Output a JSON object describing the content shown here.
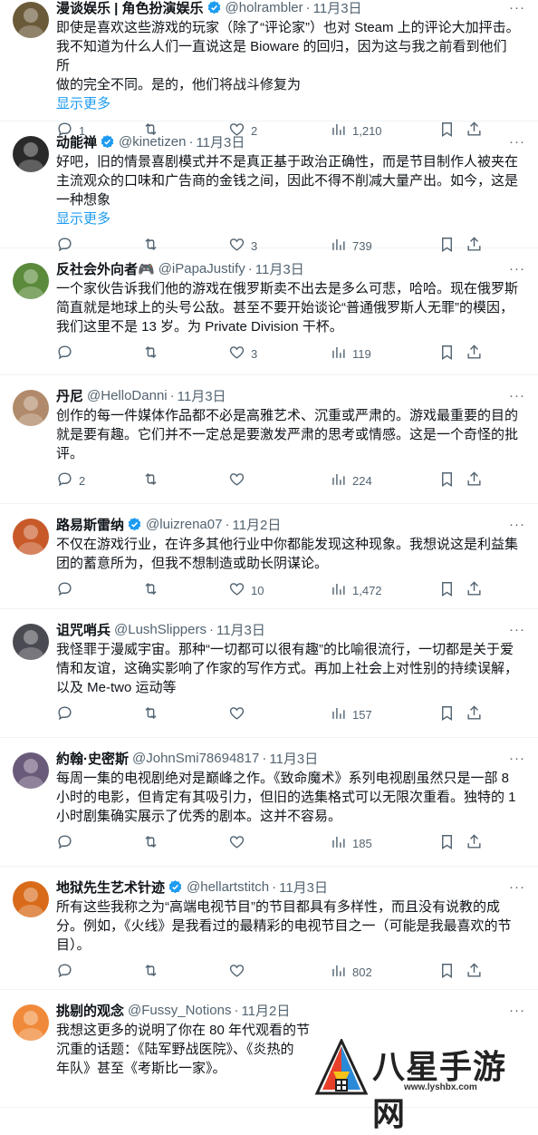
{
  "tweets": [
    {
      "name": "漫谈娱乐 | 角色扮演娱乐",
      "handle": "@holrambler",
      "time": "11月3日",
      "verified": true,
      "lines": [
        "即使是喜欢这些游戏的玩家（除了“评论家”）也对 Steam 上的评论大加抨击。",
        "我不知道为什么人们一直说这是 Bioware 的回归，因为这与我之前看到他们所",
        "做的完全不同。是的，他们将战斗修复为"
      ],
      "show_more": "显示更多",
      "replies": "1",
      "retweets": "",
      "likes": "2",
      "views": "1,210",
      "avatar_color": "#6b5a3a"
    },
    {
      "name": "动能禅",
      "handle": "@kinetizen",
      "time": "11月3日",
      "verified": true,
      "lines": [
        "好吧，旧的情景喜剧模式并不是真正基于政治正确性，而是节目制作人被夹在",
        "主流观众的口味和广告商的金钱之间，因此不得不削减大量产出。如今，这是",
        "一种想象"
      ],
      "show_more": "显示更多",
      "replies": "",
      "retweets": "",
      "likes": "3",
      "views": "739",
      "avatar_color": "#2a2a2a"
    },
    {
      "name": "反社会外向者🎮",
      "handle": "@iPapaJustify",
      "time": "11月3日",
      "verified": false,
      "lines": [
        "一个家伙告诉我们他的游戏在俄罗斯卖不出去是多么可悲，哈哈。现在俄罗斯",
        "简直就是地球上的头号公敌。甚至不要开始谈论“普通俄罗斯人无罪”的模因，",
        "我们这里不是 13 岁。为 Private Division 干杯。"
      ],
      "show_more": "",
      "replies": "",
      "retweets": "",
      "likes": "3",
      "views": "119",
      "avatar_color": "#5a8a3a"
    },
    {
      "name": "丹尼",
      "handle": "@HelloDanni",
      "time": "11月3日",
      "verified": false,
      "lines": [
        "创作的每一件媒体作品都不必是高雅艺术、沉重或严肃的。游戏最重要的目的",
        "就是要有趣。它们并不一定总是要激发严肃的思考或情感。这是一个奇怪的批",
        "评。"
      ],
      "show_more": "",
      "replies": "2",
      "retweets": "",
      "likes": "",
      "views": "224",
      "avatar_color": "#b08a6a"
    },
    {
      "name": "路易斯雷纳",
      "handle": "@luizrena07",
      "time": "11月2日",
      "verified": true,
      "lines": [
        "不仅在游戏行业，在许多其他行业中你都能发现这种现象。我想说这是利益集",
        "团的蓄意所为，但我不想制造或助长阴谋论。"
      ],
      "show_more": "",
      "replies": "",
      "retweets": "",
      "likes": "10",
      "views": "1,472",
      "avatar_color": "#c85a2a"
    },
    {
      "name": "诅咒哨兵",
      "handle": "@LushSlippers",
      "time": "11月3日",
      "verified": false,
      "lines": [
        "我怪罪于漫威宇宙。那种“一切都可以很有趣”的比喻很流行，一切都是关于爱",
        "情和友谊，这确实影响了作家的写作方式。再加上社会上对性别的持续误解，",
        "以及 Me-two 运动等"
      ],
      "show_more": "",
      "replies": "",
      "retweets": "",
      "likes": "",
      "views": "157",
      "avatar_color": "#4a4a52"
    },
    {
      "name": "約翰·史密斯",
      "handle": "@JohnSmi78694817",
      "time": "11月3日",
      "verified": false,
      "lines": [
        "每周一集的电视剧绝对是巅峰之作。《致命魔术》系列电视剧虽然只是一部 8",
        "小时的电影，但肯定有其吸引力，但旧的选集格式可以无限次重看。独特的 1",
        "小时剧集确实展示了优秀的剧本。这并不容易。"
      ],
      "show_more": "",
      "replies": "",
      "retweets": "",
      "likes": "",
      "views": "185",
      "avatar_color": "#6a5a7a"
    },
    {
      "name": "地狱先生艺术针迹",
      "handle": "@hellartstitch",
      "time": "11月3日",
      "verified": true,
      "lines": [
        "所有这些我称之为“高端电视节目”的节目都具有多样性，而且没有说教的成",
        "分。例如，《火线》是我看过的最精彩的电视节目之一（可能是我最喜欢的节",
        "目）。"
      ],
      "show_more": "",
      "replies": "",
      "retweets": "",
      "likes": "",
      "views": "802",
      "avatar_color": "#d86a1a"
    },
    {
      "name": "挑剔的观念",
      "handle": "@Fussy_Notions",
      "time": "11月2日",
      "verified": false,
      "lines": [
        "我想这更多的说明了你在 80 年代观看的节",
        "沉重的话题：《陆军野战医院》、《炎热的",
        "年队》甚至《考斯比一家》。"
      ],
      "show_more": "",
      "replies": "",
      "retweets": "",
      "likes": "",
      "views": "",
      "avatar_color": "#f08a3a"
    }
  ],
  "watermark": {
    "title": "八星手游网",
    "url": "www.lyshbx.com"
  },
  "colors": {
    "text": "#0f1419",
    "secondary": "#536471",
    "link": "#1d9bf0",
    "divider": "#eff3f4",
    "verified": "#1d9bf0"
  }
}
